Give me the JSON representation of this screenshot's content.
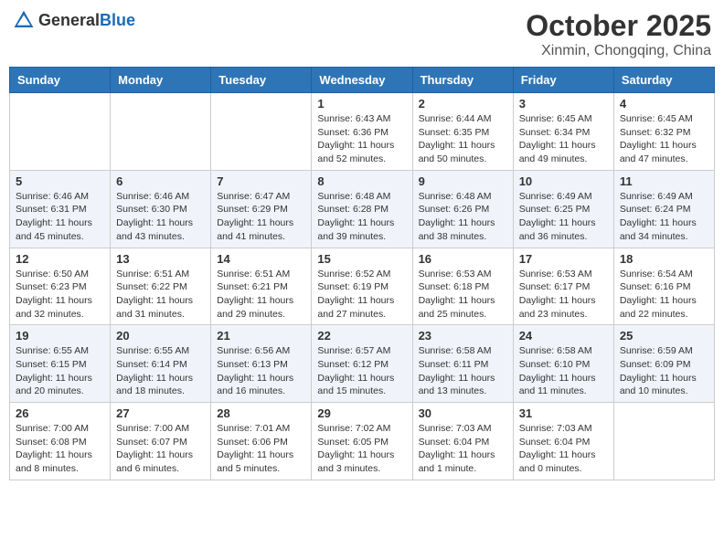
{
  "header": {
    "logo_general": "General",
    "logo_blue": "Blue",
    "month": "October 2025",
    "location": "Xinmin, Chongqing, China"
  },
  "days_of_week": [
    "Sunday",
    "Monday",
    "Tuesday",
    "Wednesday",
    "Thursday",
    "Friday",
    "Saturday"
  ],
  "weeks": [
    [
      {
        "day": "",
        "info": ""
      },
      {
        "day": "",
        "info": ""
      },
      {
        "day": "",
        "info": ""
      },
      {
        "day": "1",
        "info": "Sunrise: 6:43 AM\nSunset: 6:36 PM\nDaylight: 11 hours\nand 52 minutes."
      },
      {
        "day": "2",
        "info": "Sunrise: 6:44 AM\nSunset: 6:35 PM\nDaylight: 11 hours\nand 50 minutes."
      },
      {
        "day": "3",
        "info": "Sunrise: 6:45 AM\nSunset: 6:34 PM\nDaylight: 11 hours\nand 49 minutes."
      },
      {
        "day": "4",
        "info": "Sunrise: 6:45 AM\nSunset: 6:32 PM\nDaylight: 11 hours\nand 47 minutes."
      }
    ],
    [
      {
        "day": "5",
        "info": "Sunrise: 6:46 AM\nSunset: 6:31 PM\nDaylight: 11 hours\nand 45 minutes."
      },
      {
        "day": "6",
        "info": "Sunrise: 6:46 AM\nSunset: 6:30 PM\nDaylight: 11 hours\nand 43 minutes."
      },
      {
        "day": "7",
        "info": "Sunrise: 6:47 AM\nSunset: 6:29 PM\nDaylight: 11 hours\nand 41 minutes."
      },
      {
        "day": "8",
        "info": "Sunrise: 6:48 AM\nSunset: 6:28 PM\nDaylight: 11 hours\nand 39 minutes."
      },
      {
        "day": "9",
        "info": "Sunrise: 6:48 AM\nSunset: 6:26 PM\nDaylight: 11 hours\nand 38 minutes."
      },
      {
        "day": "10",
        "info": "Sunrise: 6:49 AM\nSunset: 6:25 PM\nDaylight: 11 hours\nand 36 minutes."
      },
      {
        "day": "11",
        "info": "Sunrise: 6:49 AM\nSunset: 6:24 PM\nDaylight: 11 hours\nand 34 minutes."
      }
    ],
    [
      {
        "day": "12",
        "info": "Sunrise: 6:50 AM\nSunset: 6:23 PM\nDaylight: 11 hours\nand 32 minutes."
      },
      {
        "day": "13",
        "info": "Sunrise: 6:51 AM\nSunset: 6:22 PM\nDaylight: 11 hours\nand 31 minutes."
      },
      {
        "day": "14",
        "info": "Sunrise: 6:51 AM\nSunset: 6:21 PM\nDaylight: 11 hours\nand 29 minutes."
      },
      {
        "day": "15",
        "info": "Sunrise: 6:52 AM\nSunset: 6:19 PM\nDaylight: 11 hours\nand 27 minutes."
      },
      {
        "day": "16",
        "info": "Sunrise: 6:53 AM\nSunset: 6:18 PM\nDaylight: 11 hours\nand 25 minutes."
      },
      {
        "day": "17",
        "info": "Sunrise: 6:53 AM\nSunset: 6:17 PM\nDaylight: 11 hours\nand 23 minutes."
      },
      {
        "day": "18",
        "info": "Sunrise: 6:54 AM\nSunset: 6:16 PM\nDaylight: 11 hours\nand 22 minutes."
      }
    ],
    [
      {
        "day": "19",
        "info": "Sunrise: 6:55 AM\nSunset: 6:15 PM\nDaylight: 11 hours\nand 20 minutes."
      },
      {
        "day": "20",
        "info": "Sunrise: 6:55 AM\nSunset: 6:14 PM\nDaylight: 11 hours\nand 18 minutes."
      },
      {
        "day": "21",
        "info": "Sunrise: 6:56 AM\nSunset: 6:13 PM\nDaylight: 11 hours\nand 16 minutes."
      },
      {
        "day": "22",
        "info": "Sunrise: 6:57 AM\nSunset: 6:12 PM\nDaylight: 11 hours\nand 15 minutes."
      },
      {
        "day": "23",
        "info": "Sunrise: 6:58 AM\nSunset: 6:11 PM\nDaylight: 11 hours\nand 13 minutes."
      },
      {
        "day": "24",
        "info": "Sunrise: 6:58 AM\nSunset: 6:10 PM\nDaylight: 11 hours\nand 11 minutes."
      },
      {
        "day": "25",
        "info": "Sunrise: 6:59 AM\nSunset: 6:09 PM\nDaylight: 11 hours\nand 10 minutes."
      }
    ],
    [
      {
        "day": "26",
        "info": "Sunrise: 7:00 AM\nSunset: 6:08 PM\nDaylight: 11 hours\nand 8 minutes."
      },
      {
        "day": "27",
        "info": "Sunrise: 7:00 AM\nSunset: 6:07 PM\nDaylight: 11 hours\nand 6 minutes."
      },
      {
        "day": "28",
        "info": "Sunrise: 7:01 AM\nSunset: 6:06 PM\nDaylight: 11 hours\nand 5 minutes."
      },
      {
        "day": "29",
        "info": "Sunrise: 7:02 AM\nSunset: 6:05 PM\nDaylight: 11 hours\nand 3 minutes."
      },
      {
        "day": "30",
        "info": "Sunrise: 7:03 AM\nSunset: 6:04 PM\nDaylight: 11 hours\nand 1 minute."
      },
      {
        "day": "31",
        "info": "Sunrise: 7:03 AM\nSunset: 6:04 PM\nDaylight: 11 hours\nand 0 minutes."
      },
      {
        "day": "",
        "info": ""
      }
    ]
  ]
}
